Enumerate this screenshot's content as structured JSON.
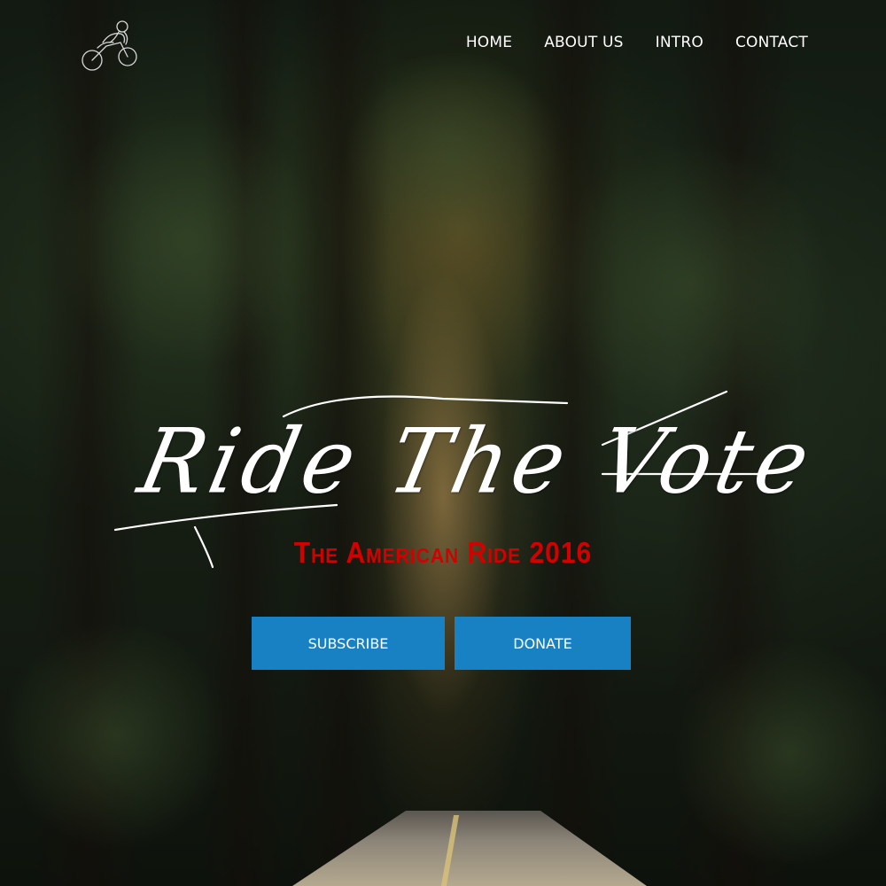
{
  "nav": {
    "logo_icon": "motorcycle-rider-icon",
    "links": [
      {
        "label": "HOME"
      },
      {
        "label": "ABOUT US"
      },
      {
        "label": "INTRO"
      },
      {
        "label": "CONTACT"
      }
    ]
  },
  "hero": {
    "headline": "Ride The Vote",
    "subtitle": "The American Ride 2016",
    "subscribe_label": "SUBSCRIBE",
    "donate_label": "DONATE"
  },
  "colors": {
    "button": "#1781c4",
    "subtitle": "#d40000",
    "text": "#ffffff"
  }
}
